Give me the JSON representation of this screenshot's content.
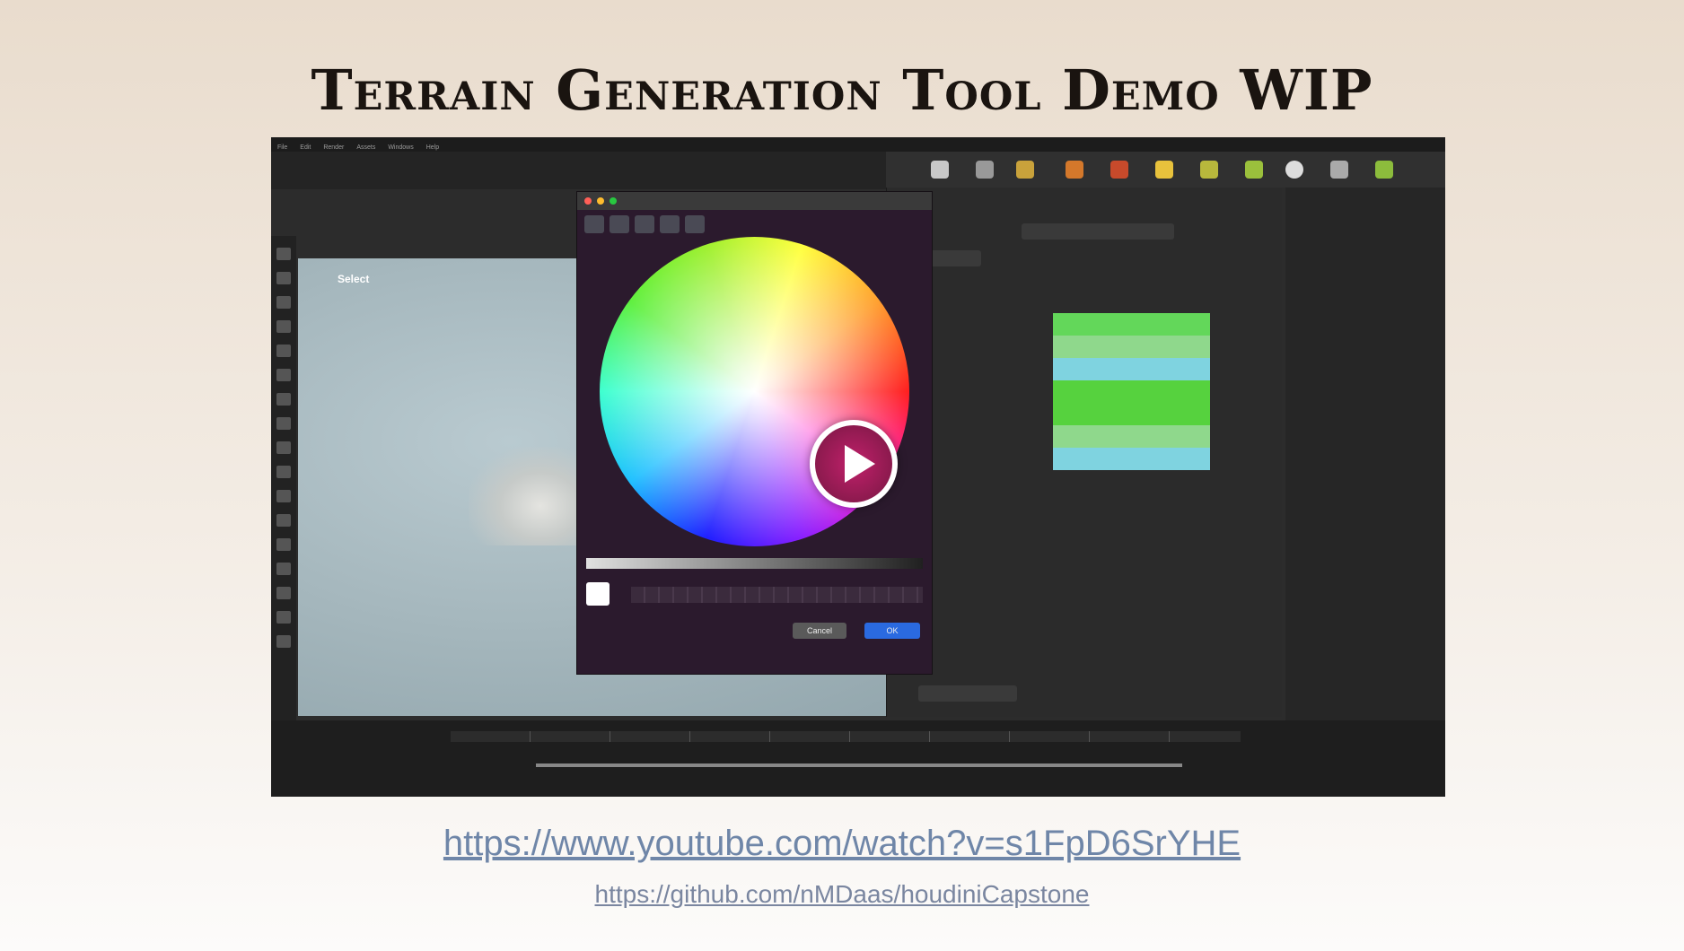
{
  "slide": {
    "title": "Terrain Generation Tool Demo WIP",
    "youtube_link": "https://www.youtube.com/watch?v=s1FpD6SrYHE",
    "github_link": "https://github.com/nMDaas/houdiniCapstone"
  },
  "video": {
    "viewport_label": "Select",
    "play_icon": "play-icon",
    "color_dialog": {
      "cancel_label": "Cancel",
      "ok_label": "OK",
      "swatch_color": "#ffffff",
      "ok_color": "#2a6ae0"
    },
    "ramp_colors": [
      "#63d75a",
      "#8fd88c",
      "#7fd3e0",
      "#56d23e",
      "#56d23e",
      "#8fd88c",
      "#7fd3e0"
    ],
    "play_button_color": "#8c1a4e"
  }
}
